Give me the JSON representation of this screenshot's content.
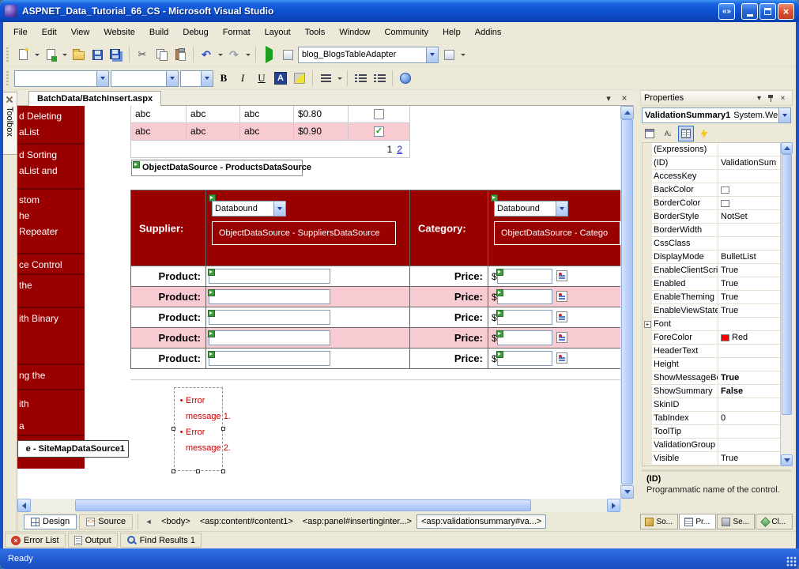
{
  "colors": {
    "maroon": "#990000",
    "pink": "#F7CBD1",
    "error": "#CC0000",
    "accent": "#316AC5"
  },
  "icons": {
    "window_nav": "«»",
    "close": "×",
    "menu_arrow": "▾",
    "back_chevron": "◄",
    "check": "✓",
    "bullet": "•",
    "expand_plus": "+"
  },
  "titlebar": {
    "title": "ASPNET_Data_Tutorial_66_CS - Microsoft Visual Studio"
  },
  "menu": {
    "items": [
      "File",
      "Edit",
      "View",
      "Website",
      "Build",
      "Debug",
      "Format",
      "Layout",
      "Tools",
      "Window",
      "Community",
      "Help",
      "Addins"
    ]
  },
  "toolbars": {
    "adapter_combo": "blog_BlogsTableAdapter",
    "bold_label": "B",
    "italic_label": "I",
    "underline_label": "U"
  },
  "toolbox": {
    "label": "Toolbox"
  },
  "editor": {
    "tab": "BatchData/BatchInsert.aspx",
    "leftnav": {
      "items": [
        {
          "lines": [
            "d Deleting",
            "aList"
          ]
        },
        {
          "lines": [
            "d Sorting",
            "aList and"
          ]
        },
        {
          "lines": [
            "stom",
            "he",
            "Repeater"
          ]
        },
        {
          "lines": [
            "ce Control"
          ]
        },
        {
          "lines": [
            "the"
          ]
        },
        {
          "lines": [
            "ith Binary"
          ]
        },
        {
          "lines": [
            "ng the"
          ]
        },
        {
          "lines": [
            "ith",
            "a"
          ]
        }
      ],
      "datasource_box": "e - SiteMapDataSource1"
    },
    "grid": {
      "rows": [
        {
          "c1": "abc",
          "c2": "abc",
          "c3": "abc",
          "price": "$0.80",
          "checked": false
        },
        {
          "c1": "abc",
          "c2": "abc",
          "c3": "abc",
          "price": "$0.90",
          "checked": true
        }
      ],
      "pager": {
        "current": "1",
        "link": "2"
      }
    },
    "products_ds": "ObjectDataSource - ProductsDataSource",
    "form": {
      "supplier_label": "Supplier:",
      "category_label": "Category:",
      "dropdown_value": "Databound",
      "suppliers_ds": "ObjectDataSource - SuppliersDataSource",
      "categories_ds": "ObjectDataSource - Catego",
      "product_label": "Product:",
      "price_label": "Price:",
      "currency": "$",
      "row_count": 5
    },
    "validation": {
      "errors": [
        {
          "lines": [
            "Error",
            "message 1."
          ]
        },
        {
          "lines": [
            "Error",
            "message 2."
          ]
        }
      ]
    }
  },
  "tagnav": {
    "design_label": "Design",
    "source_label": "Source",
    "tags": [
      {
        "label": "<body>",
        "active": false
      },
      {
        "label": "<asp:content#content1>",
        "active": false
      },
      {
        "label": "<asp:panel#insertinginter...>",
        "active": false
      },
      {
        "label": "<asp:validationsummary#va...>",
        "active": true
      }
    ]
  },
  "properties": {
    "title": "Properties",
    "object_name": "ValidationSummary1",
    "object_type": "System.We",
    "rows": [
      {
        "name": "(Expressions)",
        "value": ""
      },
      {
        "name": "(ID)",
        "value": "ValidationSum"
      },
      {
        "name": "AccessKey",
        "value": ""
      },
      {
        "name": "BackColor",
        "value": "",
        "swatch": "#FFFFFF"
      },
      {
        "name": "BorderColor",
        "value": "",
        "swatch": "#FFFFFF"
      },
      {
        "name": "BorderStyle",
        "value": "NotSet"
      },
      {
        "name": "BorderWidth",
        "value": ""
      },
      {
        "name": "CssClass",
        "value": ""
      },
      {
        "name": "DisplayMode",
        "value": "BulletList"
      },
      {
        "name": "EnableClientScri",
        "value": "True"
      },
      {
        "name": "Enabled",
        "value": "True"
      },
      {
        "name": "EnableTheming",
        "value": "True"
      },
      {
        "name": "EnableViewState",
        "value": "True"
      },
      {
        "name": "Font",
        "value": "",
        "expand": true
      },
      {
        "name": "ForeColor",
        "value": "Red",
        "swatch": "#FF0000"
      },
      {
        "name": "HeaderText",
        "value": ""
      },
      {
        "name": "Height",
        "value": ""
      },
      {
        "name": "ShowMessageBo",
        "value": "True",
        "bold": true
      },
      {
        "name": "ShowSummary",
        "value": "False",
        "bold": true
      },
      {
        "name": "SkinID",
        "value": ""
      },
      {
        "name": "TabIndex",
        "value": "0"
      },
      {
        "name": "ToolTip",
        "value": ""
      },
      {
        "name": "ValidationGroup",
        "value": ""
      },
      {
        "name": "Visible",
        "value": "True"
      }
    ],
    "description_title": "(ID)",
    "description_text": "Programmatic name of the control."
  },
  "right_tabs": [
    {
      "label": "So...",
      "icon": "solution-explorer-icon",
      "active": false
    },
    {
      "label": "Pr...",
      "icon": "properties-icon",
      "active": true
    },
    {
      "label": "Se...",
      "icon": "server-explorer-icon",
      "active": false
    },
    {
      "label": "Cl...",
      "icon": "class-view-icon",
      "active": false
    }
  ],
  "bottom_tabs": [
    {
      "label": "Error List",
      "icon": "error-list-icon"
    },
    {
      "label": "Output",
      "icon": "output-icon"
    },
    {
      "label": "Find Results 1",
      "icon": "find-results-icon"
    }
  ],
  "statusbar": {
    "text": "Ready"
  }
}
